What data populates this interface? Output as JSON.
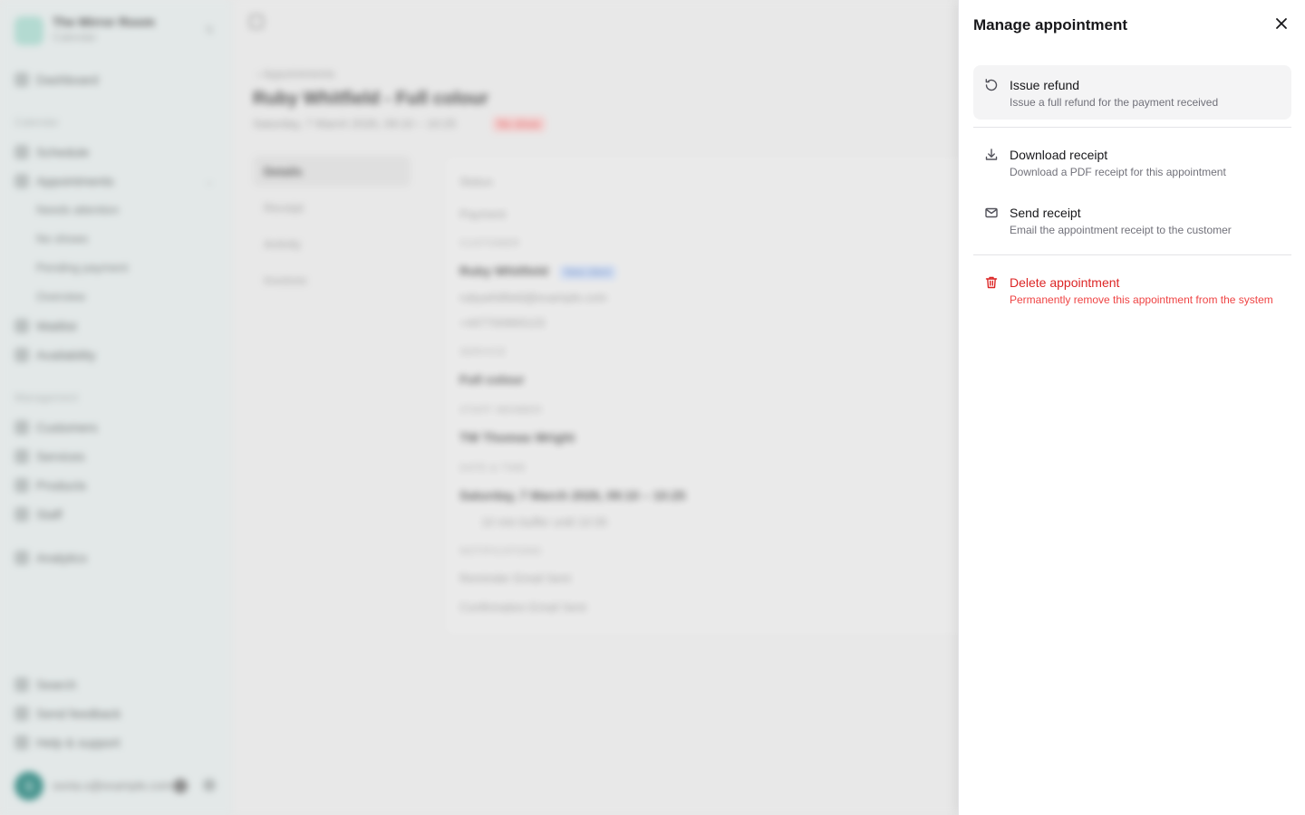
{
  "background": {
    "brand": {
      "name": "The Mirror Room",
      "subtitle": "Calendar"
    },
    "nav": {
      "dashboard": "Dashboard",
      "calendar_section": "Calendar",
      "schedule": "Schedule",
      "appointments": "Appointments",
      "appointments_sub": [
        "Needs attention",
        "No shows",
        "Pending payment",
        "Overview"
      ],
      "waitlist": "Waitlist",
      "availability": "Availability",
      "management_section": "Management",
      "customers": "Customers",
      "services": "Services",
      "products": "Products",
      "staff": "Staff",
      "analytics": "Analytics",
      "search": "Search",
      "feedback": "Send feedback",
      "help": "Help & support"
    },
    "user": {
      "initial": "S",
      "email": "sonia.s@example.com"
    },
    "page": {
      "breadcrumb": "‹  Appointments",
      "title": "Ruby Whitfield - Full colour",
      "subtitle": "Saturday, 7 March 2026, 09:10 – 10:25",
      "status_badge": "No show",
      "tabs": [
        "Details",
        "Receipt",
        "Activity",
        "Invoices"
      ],
      "details": {
        "status_label": "Status",
        "payment_label": "Payment",
        "customer_heading": "CUSTOMER",
        "customer_name": "Ruby Whitfield",
        "customer_chip": "New client",
        "customer_email": "rubywhitfield@example.com",
        "customer_phone": "+447700900123",
        "service_heading": "SERVICE",
        "service_name": "Full colour",
        "staff_heading": "STAFF MEMBER",
        "staff_name": "TW  Thomas Wright",
        "datetime_heading": "DATE & TIME",
        "datetime_value": "Saturday, 7 March 2026, 09:10 – 10:25",
        "datetime_note": "10 min buffer until 10:35",
        "notifications_heading": "NOTIFICATIONS",
        "notif_reminder": "Reminder    Email    Sent",
        "notif_confirmation": "Confirmation    Email    Sent"
      }
    }
  },
  "sheet": {
    "title": "Manage appointment",
    "close_icon": "close-icon",
    "actions": [
      {
        "icon": "refresh-icon",
        "label": "Issue refund",
        "description": "Issue a full refund for the payment received"
      },
      {
        "icon": "download-icon",
        "label": "Download receipt",
        "description": "Download a PDF receipt for this appointment"
      },
      {
        "icon": "mail-icon",
        "label": "Send receipt",
        "description": "Email the appointment receipt to the customer"
      },
      {
        "icon": "trash-icon",
        "label": "Delete appointment",
        "description": "Permanently remove this appointment from the system"
      }
    ],
    "colors": {
      "danger": "#dc2626",
      "hover_bg": "#f4f4f5",
      "text": "#18181b",
      "muted": "#71717a"
    }
  }
}
